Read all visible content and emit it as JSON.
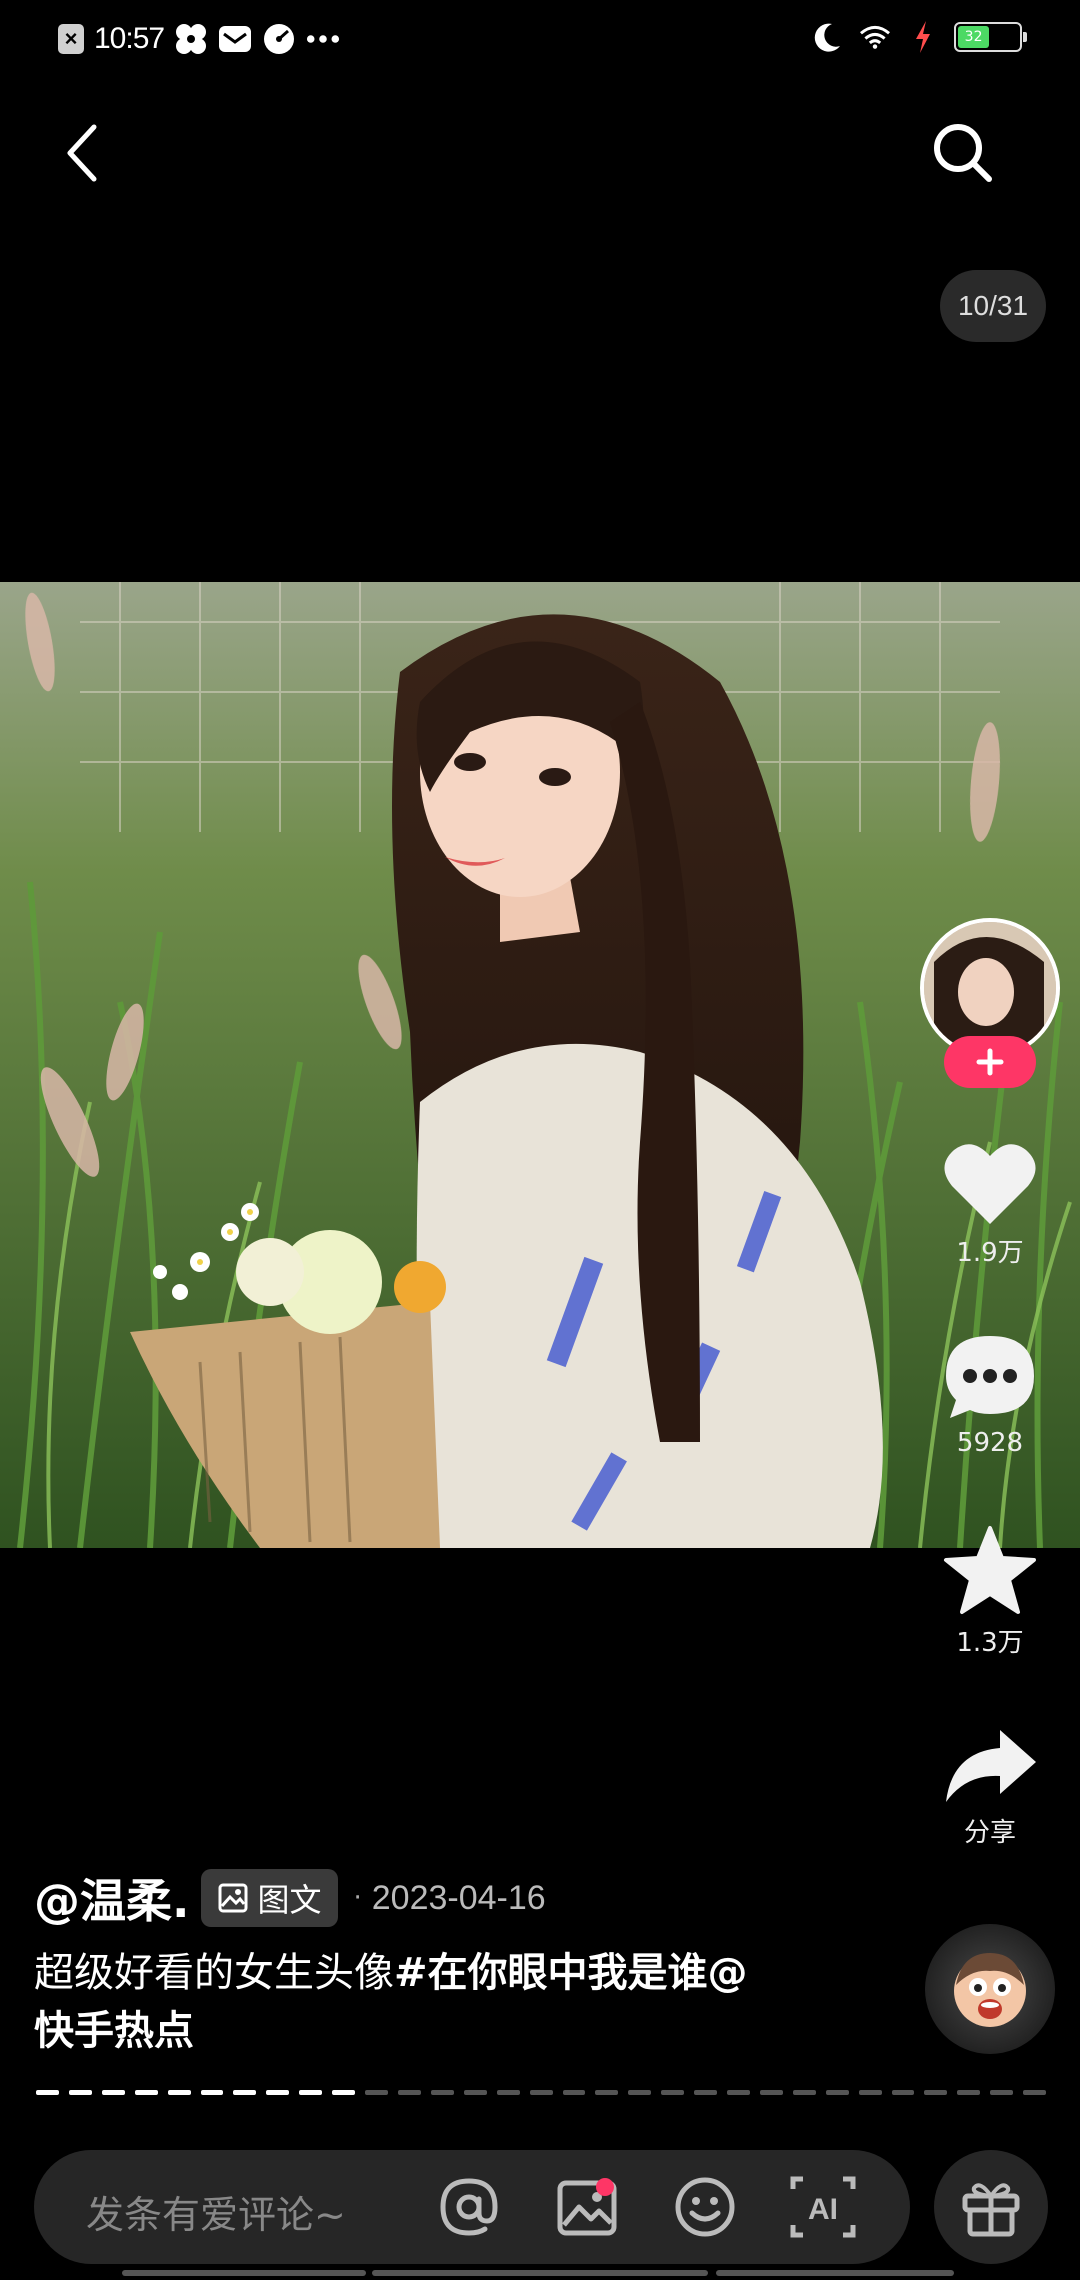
{
  "status_bar": {
    "time": "10:57",
    "battery": "32",
    "battery_color": "#4cd964"
  },
  "nav": {
    "back_icon": "chevron-left-icon",
    "search_icon": "search-icon"
  },
  "image_counter": "10/31",
  "photo": {
    "alt": "girl with long hair holding flower bouquet in tall grass"
  },
  "rail": {
    "like_count": "1.9万",
    "comment_count": "5928",
    "favorite_count": "1.3万",
    "share_label": "分享"
  },
  "post": {
    "author": "@温柔.",
    "type_label": "图文",
    "date": "2023-04-16",
    "caption_text": "超级好看的女生头像",
    "caption_hashtag": "#在你眼中我是谁",
    "caption_mention": "@快手热点"
  },
  "progress": {
    "total": 31,
    "current": 10
  },
  "comment_bar": {
    "placeholder": "发条有爱评论~",
    "icons": [
      "at-icon",
      "image-icon",
      "emoji-icon",
      "ai-icon"
    ],
    "accent": "#fe3666"
  }
}
